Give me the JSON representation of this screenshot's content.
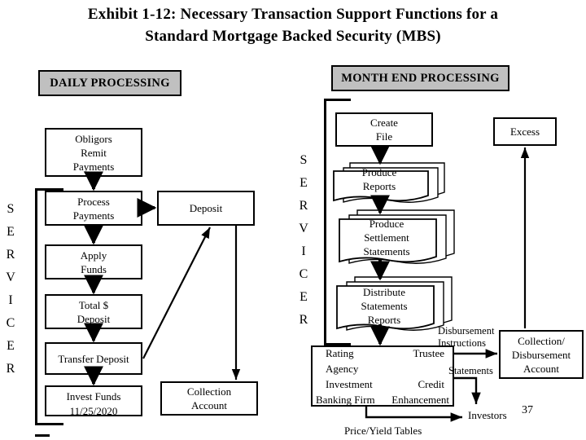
{
  "title": {
    "line1": "Exhibit 1-12: Necessary Transaction Support Functions for a",
    "line2": "Standard Mortgage Backed Security (MBS)"
  },
  "headers": {
    "daily": "DAILY PROCESSING",
    "month_end": "MONTH END PROCESSING"
  },
  "vertical_labels": {
    "left_servicer": "SERVICER",
    "right_servicer": "SERVICER"
  },
  "daily_flow": {
    "obligors": {
      "l1": "Obligors",
      "l2": "Remit",
      "l3": "Payments"
    },
    "process": {
      "l1": "Process",
      "l2": "Payments"
    },
    "deposit": {
      "l1": "Deposit"
    },
    "apply": {
      "l1": "Apply",
      "l2": "Funds"
    },
    "total": {
      "l1": "Total $",
      "l2": "Deposit"
    },
    "transfer": {
      "l1": "Transfer Deposit"
    },
    "invest": {
      "l1": "Invest Funds",
      "l2": "11/25/2020"
    },
    "collection": {
      "l1": "Collection",
      "l2": "Account"
    }
  },
  "month_end_flow": {
    "create_file": {
      "l1": "Create",
      "l2": "File"
    },
    "produce_reports": {
      "l1": "Produce",
      "l2": "Reports"
    },
    "produce_settlement": {
      "l1": "Produce",
      "l2": "Settlement",
      "l3": "Statements"
    },
    "distribute": {
      "l1": "Distribute",
      "l2": "Statements",
      "l3": "Reports"
    },
    "excess": {
      "l1": "Excess"
    },
    "collection_disbursement": {
      "l1": "Collection/",
      "l2": "Disbursement",
      "l3": "Account"
    },
    "parties": {
      "row1_left": "Rating",
      "row1_right": "Trustee",
      "row2_left": "Agency",
      "row2_right": "",
      "row3_left": "Investment",
      "row3_right": "Credit",
      "row4_left": "Banking Firm",
      "row4_right": "Enhancement"
    }
  },
  "edge_labels": {
    "disbursement_instructions_l1": "Disbursement",
    "disbursement_instructions_l2": "Instructions",
    "statements": "Statements",
    "investors": "Investors",
    "price_yield": "Price/Yield Tables"
  },
  "page_number": "37",
  "colors": {
    "header_fill": "#c0c0c0",
    "line": "#000000",
    "background": "#ffffff"
  }
}
